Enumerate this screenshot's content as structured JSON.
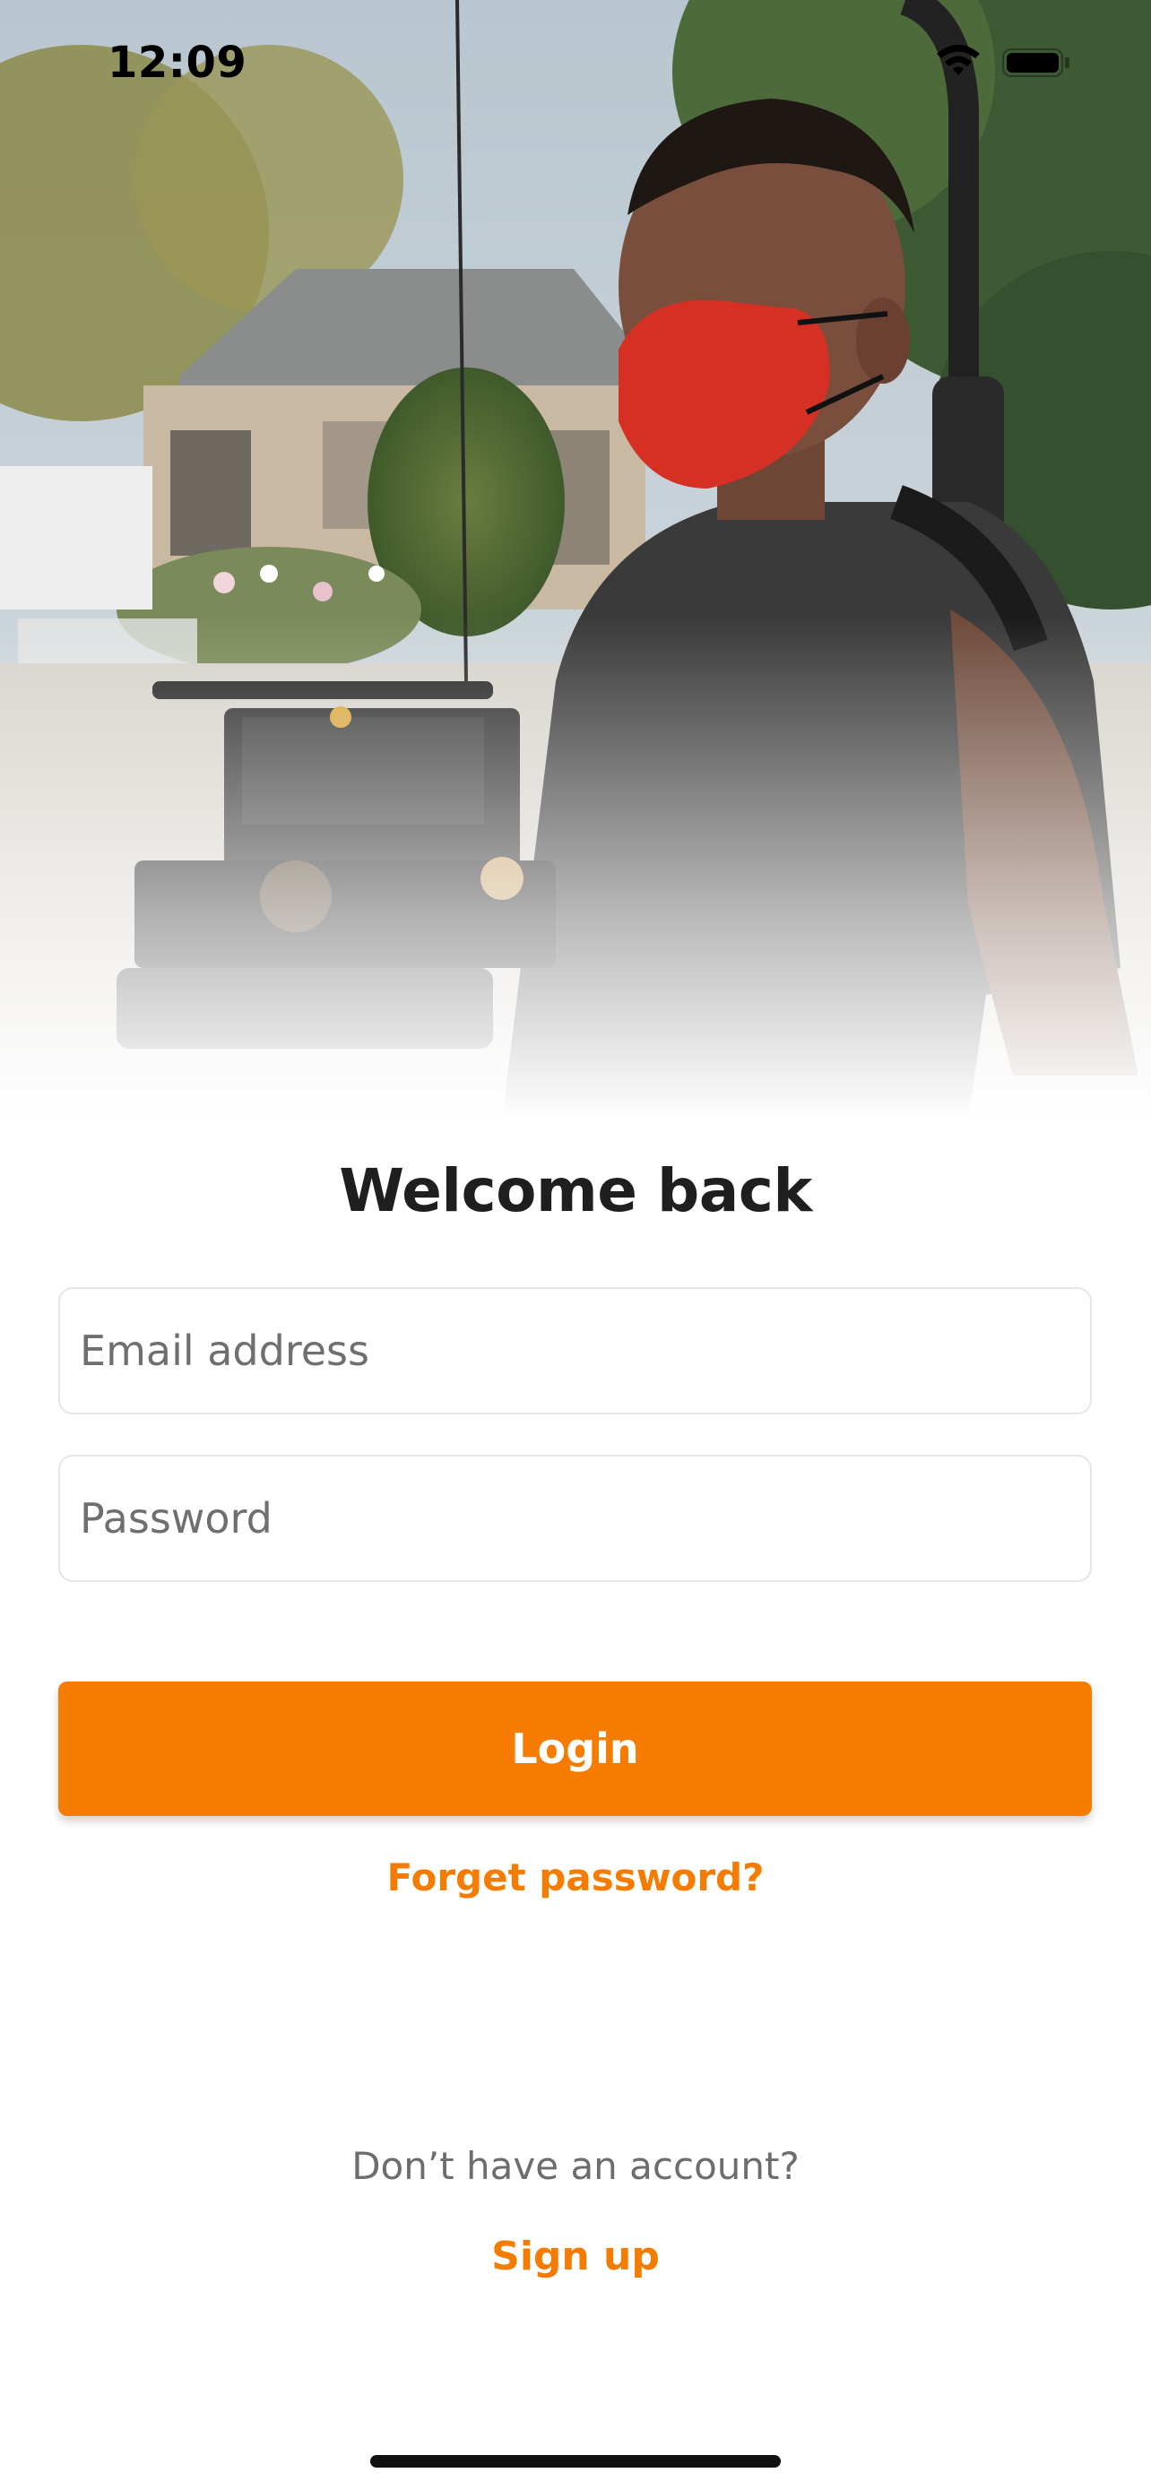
{
  "status_bar": {
    "time": "12:09",
    "icons": [
      "wifi-icon",
      "battery-icon"
    ]
  },
  "hero": {
    "image": "person-with-red-mask-holding-camera-rig"
  },
  "login": {
    "title": "Welcome back",
    "email_placeholder": "Email address",
    "password_placeholder": "Password",
    "login_label": "Login",
    "forgot_label": "Forget password?",
    "no_account_text": "Don’t have an account?",
    "signup_label": "Sign up"
  },
  "colors": {
    "accent": "#f57c00",
    "title_text": "#1f1f1f",
    "muted_text": "#6d6d6d",
    "field_border": "#e6e6e6"
  }
}
